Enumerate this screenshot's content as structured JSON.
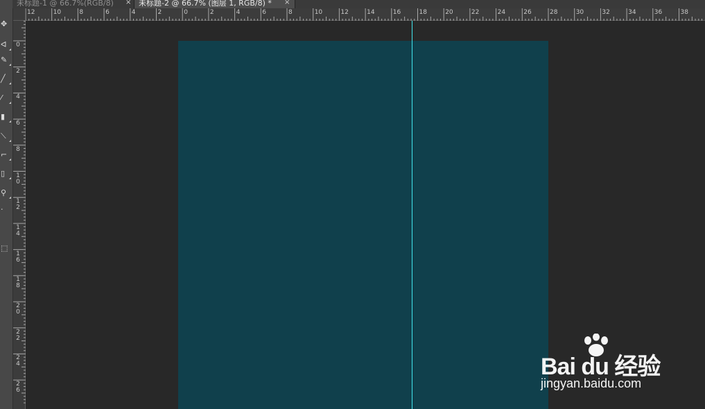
{
  "tabs": [
    {
      "label": "未标题-1 @ 66.7%(RGB/8)",
      "close": "×",
      "active": false
    },
    {
      "label": "未标题-2 @ 66.7% (图层 1, RGB/8) *",
      "close": "×",
      "active": true
    }
  ],
  "toolbar": {
    "tools": [
      {
        "name": "move-tool",
        "glyph": "✥"
      },
      {
        "name": "lasso-tool",
        "glyph": "ᐊ"
      },
      {
        "name": "brush-tool",
        "glyph": "✎"
      },
      {
        "name": "pencil-tool",
        "glyph": "╱"
      },
      {
        "name": "history-brush-tool",
        "glyph": "⁄"
      },
      {
        "name": "eraser-tool",
        "glyph": "▮"
      },
      {
        "name": "dodge-tool",
        "glyph": "⟍"
      },
      {
        "name": "path-selection-tool",
        "glyph": "⌐"
      },
      {
        "name": "rectangle-tool",
        "glyph": "▯"
      },
      {
        "name": "zoom-tool",
        "glyph": "⚲"
      },
      {
        "name": "edit-toolbar-button",
        "glyph": "·"
      },
      {
        "name": "quick-mask-button",
        "glyph": "⬚"
      }
    ]
  },
  "rulers": {
    "horizontal": [
      "12",
      "10",
      "8",
      "6",
      "4",
      "2",
      "0",
      "2",
      "4",
      "6",
      "8",
      "10",
      "12",
      "14",
      "16",
      "18",
      "20",
      "22",
      "24",
      "26",
      "28",
      "30",
      "32",
      "34",
      "36",
      "38"
    ],
    "vertical": [
      "0",
      "2",
      "4",
      "6",
      "8",
      "10",
      "12",
      "14",
      "16",
      "18",
      "20",
      "22",
      "24",
      "26"
    ]
  },
  "colors": {
    "document_fill": "#10404c",
    "guide": "#41e6ee",
    "workspace": "#282828"
  },
  "watermark": {
    "logo_text": "Bai du 经验",
    "url": "jingyan.baidu.com"
  }
}
